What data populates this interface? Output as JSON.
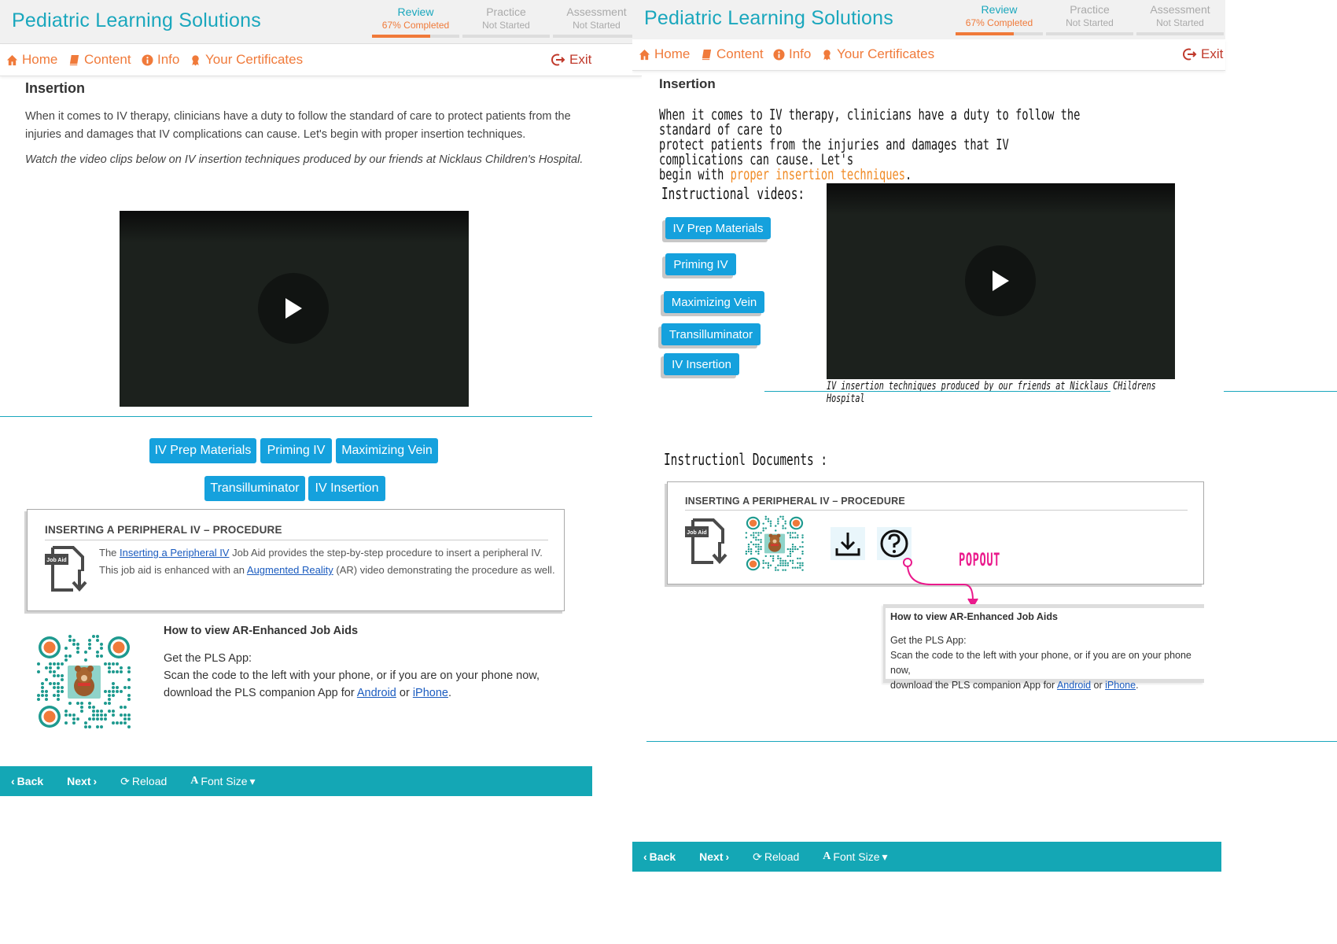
{
  "header": {
    "brand": "Pediatric Learning Solutions",
    "tabs": [
      {
        "name": "Review",
        "status": "67% Completed",
        "progress": 0.67,
        "active": true
      },
      {
        "name": "Practice",
        "status": "Not Started",
        "progress": 0,
        "active": false
      },
      {
        "name": "Assessment",
        "status": "Not Started",
        "progress": 0,
        "active": false
      }
    ]
  },
  "nav": {
    "home": "Home",
    "content": "Content",
    "info": "Info",
    "certificates": "Your Certificates",
    "exit": "Exit"
  },
  "page": {
    "title": "Insertion",
    "intro": "When it comes to IV therapy, clinicians have a duty to follow the standard of care to protect patients from the injuries and damages that IV complications can cause. Let's begin with proper insertion techniques.",
    "watch_note": "Watch the video clips below on IV insertion techniques produced by our friends at Nicklaus Children's Hospital."
  },
  "video_buttons": [
    "IV Prep Materials",
    "Priming IV",
    "Maximizing Vein",
    "Transilluminator",
    "IV Insertion"
  ],
  "job_aid": {
    "title": "INSERTING A PERIPHERAL IV – PROCEDURE",
    "icon_label": "Job Aid",
    "text_1": "The ",
    "link_1": "Inserting a Peripheral IV",
    "text_2": " Job Aid provides the step-by-step procedure to insert a peripheral IV.",
    "text_3": "This job aid is enhanced with an ",
    "link_2": "Augmented Reality",
    "text_4": " (AR) video demonstrating the procedure as well."
  },
  "howto": {
    "title": "How to view AR-Enhanced Job Aids",
    "line1": "Get the PLS App:",
    "line2": "Scan the code to the left with your phone, or if you are on your phone now,",
    "line3": "download the PLS companion App for ",
    "android": "Android",
    "or": " or ",
    "iphone": "iPhone",
    "period": "."
  },
  "footer": {
    "back": "Back",
    "next": "Next",
    "reload": "Reload",
    "font_size": "Font Size"
  },
  "mockup": {
    "intro_start": "When it comes to IV therapy, clinicians have a duty to follow the standard of care to",
    "intro_mid": "protect patients from the injuries and damages that IV complications can cause. Let's",
    "intro_end_prefix": "begin with ",
    "intro_highlight": "proper insertion techniques",
    "intro_end_suffix": ".",
    "videos_label": "Instructional videos:",
    "video_caption": "IV insertion techniques produced by our friends at Nicklaus CHildrens Hospital",
    "documents_label": "Instructionl Documents :",
    "popout_label": "POPOUT"
  },
  "colors": {
    "brand_teal": "#1aa7bd",
    "accent_orange": "#f07a3a",
    "button_blue": "#15a1dd",
    "footer_teal": "#14a7b5",
    "popout_pink": "#ea1a8c"
  }
}
